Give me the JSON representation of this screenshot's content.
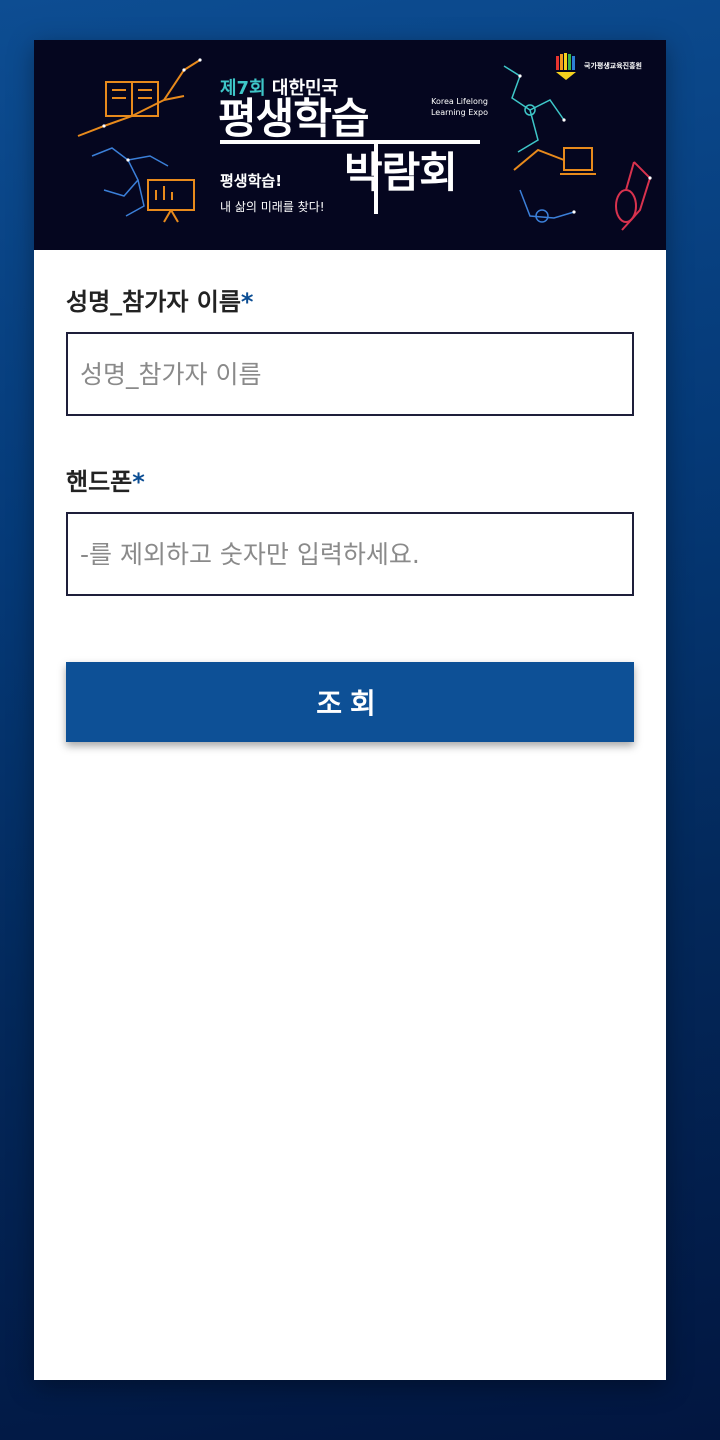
{
  "banner": {
    "edition_num": "제7회",
    "edition_rest": " 대한민국",
    "title_line1": "평생학습",
    "title_line2": "박람회",
    "expo_en": "Korea Lifelong Learning Expo",
    "slogan1": "평생학습!",
    "slogan2": "내 삶의 미래를 찾다!",
    "org_name": "국가평생교육진흥원"
  },
  "form": {
    "name_label": "성명_참가자 이름",
    "name_required_mark": "*",
    "name_placeholder": "성명_참가자 이름",
    "name_value": "",
    "phone_label": "핸드폰",
    "phone_required_mark": "*",
    "phone_placeholder": "-를 제외하고 숫자만 입력하세요.",
    "phone_value": "",
    "submit_label": "조회"
  },
  "colors": {
    "accent": "#0d5096",
    "banner_bg": "#05061f",
    "edition_accent": "#3ec6c8"
  }
}
